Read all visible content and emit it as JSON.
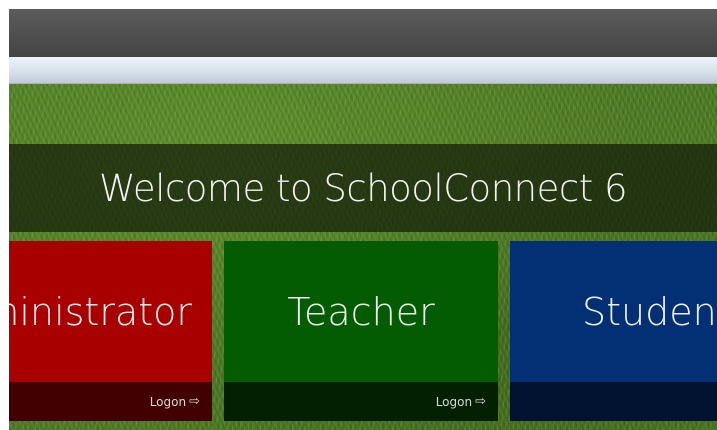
{
  "welcome": {
    "text": "Welcome to SchoolConnect 6"
  },
  "tiles": [
    {
      "role": "administrator",
      "title": "ministrator",
      "logon_label": "Logon",
      "color": "#a80000"
    },
    {
      "role": "teacher",
      "title": "Teacher",
      "logon_label": "Logon",
      "color": "#035c02"
    },
    {
      "role": "student",
      "title": "Student",
      "color": "#033075"
    }
  ],
  "icons": {
    "logon_arrow": "arrow-right-icon"
  }
}
